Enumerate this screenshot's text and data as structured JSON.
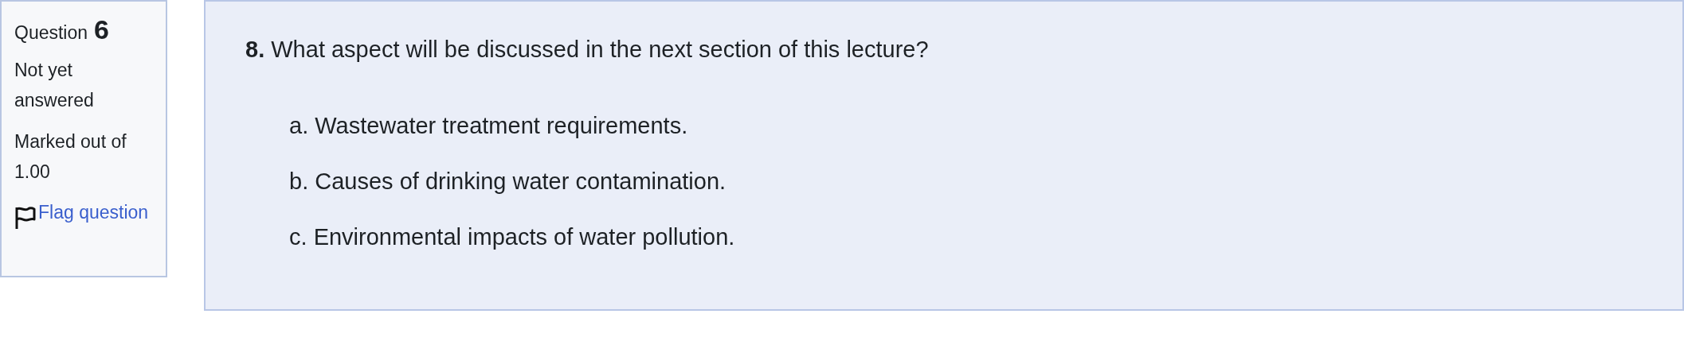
{
  "info": {
    "label": "Question",
    "number": "6",
    "status": "Not yet answered",
    "marks": "Marked out of 1.00",
    "flag_link": "Flag question"
  },
  "question": {
    "number": "8.",
    "text": "What aspect will be discussed in the next section of this lecture?",
    "options": [
      {
        "label": "a.",
        "text": "Wastewater treatment requirements."
      },
      {
        "label": "b.",
        "text": "Causes of drinking water contamination."
      },
      {
        "label": "c.",
        "text": "Environmental impacts of water pollution."
      }
    ]
  }
}
